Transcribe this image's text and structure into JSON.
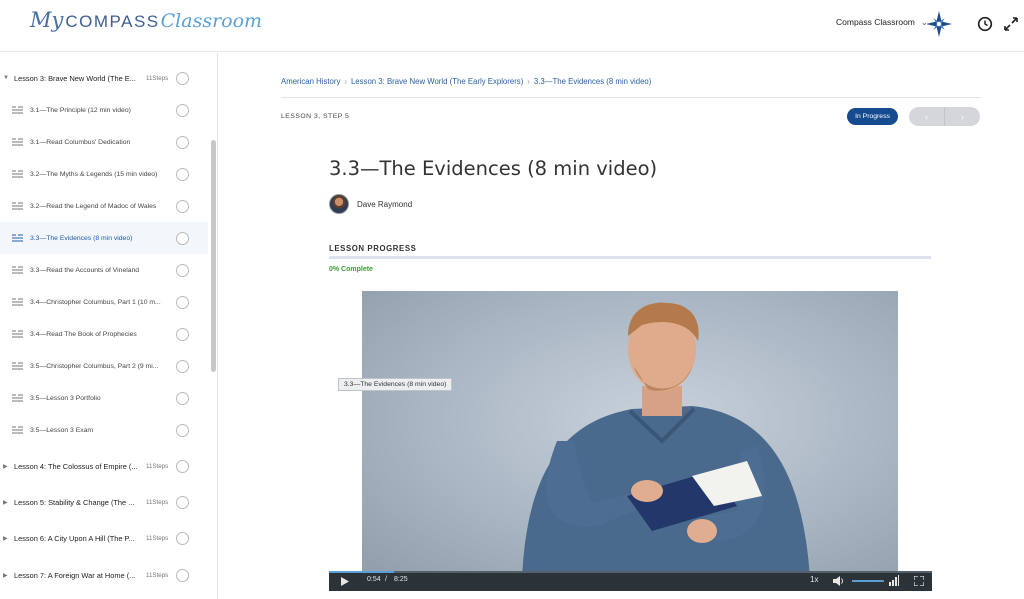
{
  "header": {
    "logo": {
      "my": "My",
      "compass": "COMPASS",
      "classroom": "Classroom"
    },
    "user_menu_label": "Compass Classroom"
  },
  "sidebar": {
    "lessons_top": [
      {
        "title": "Lesson 3: Brave New World (The E...",
        "steps": "11Steps",
        "expanded": true
      }
    ],
    "topics": [
      {
        "title": "3.1—The Principle (12 min video)",
        "active": false
      },
      {
        "title": "3.1—Read Columbus' Dedication",
        "active": false
      },
      {
        "title": "3.2—The Myths & Legends (15 min video)",
        "active": false
      },
      {
        "title": "3.2—Read the Legend of Madoc of Wales",
        "active": false
      },
      {
        "title": "3.3—The Evidences (8 min video)",
        "active": true
      },
      {
        "title": "3.3—Read the Accounts of Vineland",
        "active": false
      },
      {
        "title": "3.4—Christopher Columbus, Part 1 (10 m...",
        "active": false
      },
      {
        "title": "3.4—Read The Book of Prophecies",
        "active": false
      },
      {
        "title": "3.5—Christopher Columbus, Part 2 (9 mi...",
        "active": false
      },
      {
        "title": "3.5—Lesson 3 Portfolio",
        "active": false
      },
      {
        "title": "3.5—Lesson 3 Exam",
        "active": false
      }
    ],
    "lessons_bottom": [
      {
        "title": "Lesson 4: The Colossus of Empire (...",
        "steps": "11Steps"
      },
      {
        "title": "Lesson 5: Stability & Change (The ...",
        "steps": "11Steps"
      },
      {
        "title": "Lesson 6: A City Upon A Hill (The P...",
        "steps": "11Steps"
      },
      {
        "title": "Lesson 7: A Foreign War at Home (...",
        "steps": "11Steps"
      }
    ]
  },
  "breadcrumb": {
    "items": [
      "American History",
      "Lesson 3: Brave New World (The Early Explorers)",
      "3.3—The Evidences (8 min video)"
    ],
    "separator": "›"
  },
  "step_label": "LESSON 3, STEP 5",
  "status": "In Progress",
  "nav": {
    "prev": "‹",
    "next": "›"
  },
  "page_title": "3.3—The Evidences (8 min video)",
  "author": "Dave Raymond",
  "progress": {
    "heading": "LESSON PROGRESS",
    "text": "0% Complete",
    "fraction": 0.0
  },
  "video": {
    "tooltip": "3.3—The Evidences (8 min video)",
    "current_time": "0:54",
    "duration": "8:25",
    "played_fraction": 0.107,
    "speed": "1x",
    "volume_fraction": 0.94
  },
  "colors": {
    "accent": "#164b8f",
    "link": "#2a62a5",
    "progress_green": "#3d9b35",
    "active_row": "#f3f6fa"
  }
}
